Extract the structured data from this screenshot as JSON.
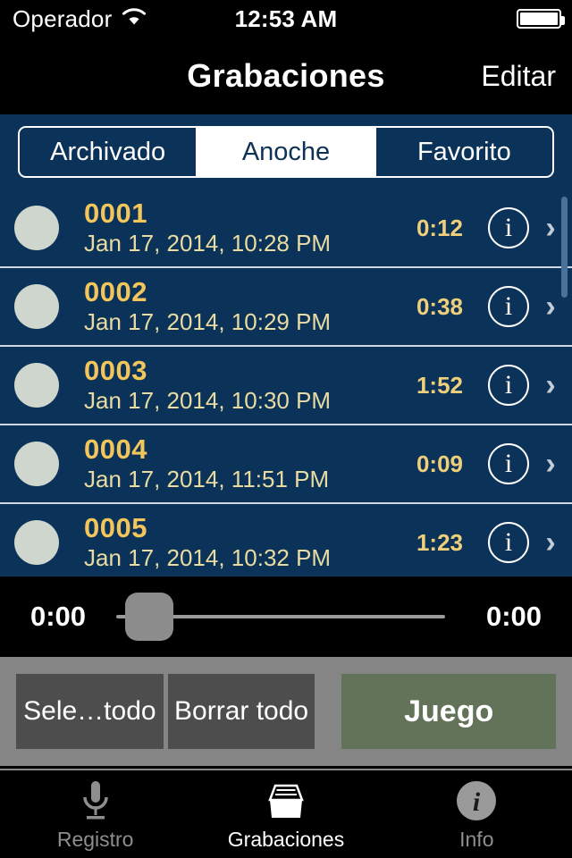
{
  "status_bar": {
    "carrier": "Operador",
    "wifi_icon": "wifi-icon",
    "time": "12:53 AM",
    "battery_icon": "battery-full-icon",
    "battery_level_pct": 100
  },
  "nav_bar": {
    "title": "Grabaciones",
    "edit_label": "Editar"
  },
  "segmented_control": {
    "selected_index": 1,
    "segments": [
      {
        "label": "Archivado"
      },
      {
        "label": "Anoche"
      },
      {
        "label": "Favorito"
      }
    ]
  },
  "recordings": [
    {
      "name": "0001",
      "date": "Jan 17, 2014, 10:28 PM",
      "duration": "0:12",
      "info_icon": "info-circle-icon",
      "chevron_icon": "chevron-right-icon"
    },
    {
      "name": "0002",
      "date": "Jan 17, 2014, 10:29 PM",
      "duration": "0:38",
      "info_icon": "info-circle-icon",
      "chevron_icon": "chevron-right-icon"
    },
    {
      "name": "0003",
      "date": "Jan 17, 2014, 10:30 PM",
      "duration": "1:52",
      "info_icon": "info-circle-icon",
      "chevron_icon": "chevron-right-icon"
    },
    {
      "name": "0004",
      "date": "Jan 17, 2014, 11:51 PM",
      "duration": "0:09",
      "info_icon": "info-circle-icon",
      "chevron_icon": "chevron-right-icon"
    },
    {
      "name": "0005",
      "date": "Jan 17, 2014, 10:32 PM",
      "duration": "1:23",
      "info_icon": "info-circle-icon",
      "chevron_icon": "chevron-right-icon"
    }
  ],
  "player": {
    "elapsed": "0:00",
    "remaining": "0:00",
    "progress_pct": 0
  },
  "action_buttons": {
    "select_all": "Sele…todo",
    "delete_all": "Borrar todo",
    "play": "Juego"
  },
  "tab_bar": {
    "active_index": 1,
    "tabs": [
      {
        "label": "Registro",
        "icon": "microphone-icon"
      },
      {
        "label": "Grabaciones",
        "icon": "inbox-tray-icon"
      },
      {
        "label": "Info",
        "icon": "info-circle-filled-icon"
      }
    ]
  },
  "colors": {
    "list_background": "#0b3258",
    "accent_gold": "#f3c65c",
    "subtitle_gold": "#e9dca2",
    "play_button_green": "#62735a",
    "tray_background": "#858585",
    "tray_button": "#4d4d4d",
    "circle_avatar": "#ced6cd"
  }
}
